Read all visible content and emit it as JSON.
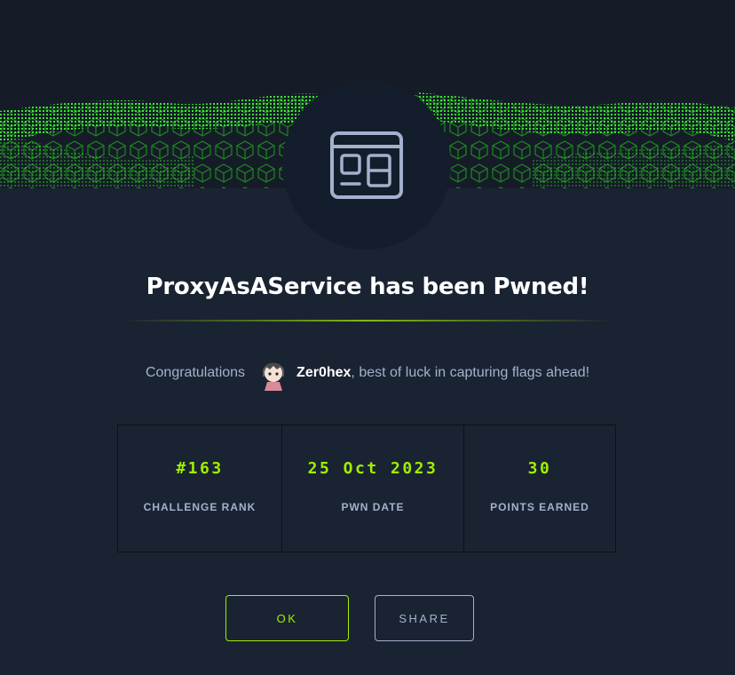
{
  "modal": {
    "title": "ProxyAsAService has been Pwned!",
    "congrats_prefix": "Congratulations",
    "username": "Zer0hex",
    "congrats_suffix": ", best of luck in capturing flags ahead!"
  },
  "stats": [
    {
      "value": "#163",
      "label": "CHALLENGE RANK"
    },
    {
      "value": "25 Oct 2023",
      "label": "PWN DATE"
    },
    {
      "value": "30",
      "label": "POINTS EARNED"
    }
  ],
  "buttons": {
    "ok_label": "OK",
    "share_label": "SHARE"
  },
  "icons": {
    "challenge": "web-window-icon",
    "banner": "green-cube-wave-banner"
  },
  "colors": {
    "background": "#1a2332",
    "accent": "#9fef00",
    "muted_text": "#a4b1cd"
  }
}
